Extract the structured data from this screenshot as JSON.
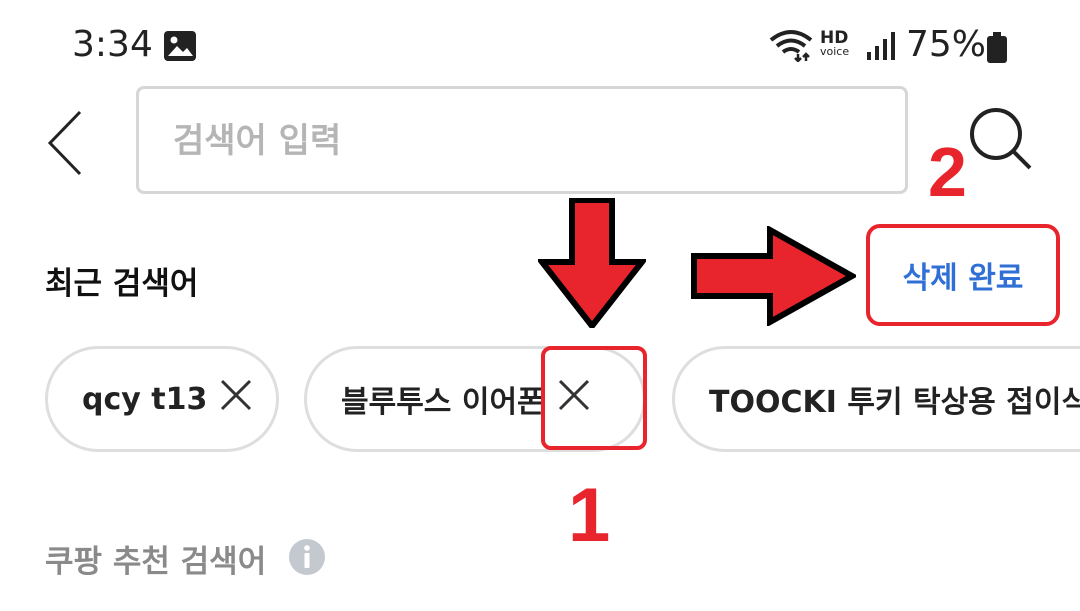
{
  "status_bar": {
    "time": "3:34",
    "hd_top": "HD",
    "hd_bottom": "voice",
    "battery": "75%"
  },
  "search": {
    "placeholder": "검색어 입력"
  },
  "recent": {
    "title": "최근 검색어",
    "delete_done_label": "삭제 완료",
    "chips": [
      "qcy t13",
      "블루투스 이어폰",
      "TOOCKI 투키 탁상용 접이식"
    ]
  },
  "annotations": {
    "label_1": "1",
    "label_2": "2",
    "accent_color": "#e8242c"
  },
  "recommend": {
    "title": "쿠팡 추천 검색어"
  },
  "icons": [
    "image-icon",
    "wifi-icon",
    "signal-icon",
    "battery-icon",
    "back-icon",
    "search-icon",
    "close-icon",
    "info-icon"
  ],
  "colors": {
    "link_blue": "#2f6fd6",
    "border_gray": "#d6d6d6"
  }
}
